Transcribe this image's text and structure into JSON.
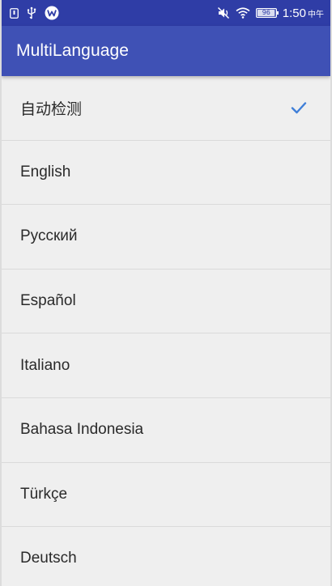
{
  "status_bar": {
    "time": "1:50",
    "time_suffix": "中午",
    "battery": "96",
    "icons": [
      "sim-icon",
      "usb-icon",
      "w-app-icon",
      "mute-vibrate-icon",
      "wifi-icon",
      "battery-icon"
    ]
  },
  "app_bar": {
    "title": "MultiLanguage"
  },
  "languages": {
    "items": [
      {
        "label": "自动检测",
        "selected": true
      },
      {
        "label": "English",
        "selected": false
      },
      {
        "label": "Русский",
        "selected": false
      },
      {
        "label": "Español",
        "selected": false
      },
      {
        "label": "Italiano",
        "selected": false
      },
      {
        "label": "Bahasa Indonesia",
        "selected": false
      },
      {
        "label": "Türkçe",
        "selected": false
      },
      {
        "label": "Deutsch",
        "selected": false
      }
    ]
  },
  "colors": {
    "status_bar": "#2f3da6",
    "app_bar": "#3f51b5",
    "check": "#3f7fd8",
    "background": "#efefef"
  }
}
